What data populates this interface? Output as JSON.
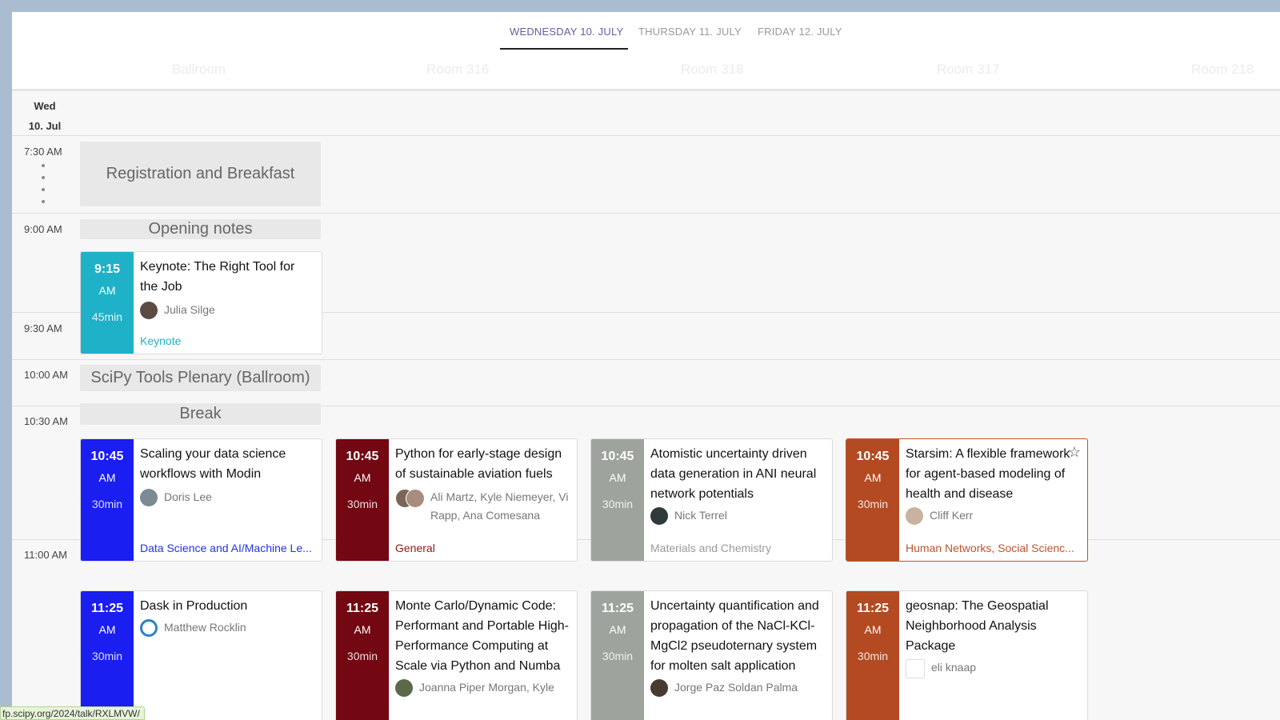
{
  "tabs": [
    {
      "label": "WEDNESDAY 10. JULY",
      "active": true
    },
    {
      "label": "THURSDAY 11. JULY",
      "active": false
    },
    {
      "label": "FRIDAY 12. JULY",
      "active": false
    }
  ],
  "rooms": [
    "Ballroom",
    "Room 316",
    "Room 318",
    "Room 317",
    "Room 218"
  ],
  "day": {
    "weekday": "Wed",
    "date": "10. Jul"
  },
  "times": [
    "7:30 AM",
    "9:00 AM",
    "9:30 AM",
    "10:00 AM",
    "10:30 AM",
    "11:00 AM"
  ],
  "blocks": {
    "registration": "Registration and Breakfast",
    "opening": "Opening notes",
    "plenary": "SciPy Tools Plenary (Ballroom)",
    "break": "Break"
  },
  "talks": {
    "keynote": {
      "time": "9:15",
      "ampm": "AM",
      "duration": "45min",
      "title": "Keynote: The Right Tool for the Job",
      "speaker": "Julia Silge",
      "track": "Keynote",
      "color": "#1fb1c7",
      "track_color": "#1fb1c7"
    },
    "modin": {
      "time": "10:45",
      "ampm": "AM",
      "duration": "30min",
      "title": "Scaling your data science workflows with Modin",
      "speaker": "Doris Lee",
      "track": "Data Science and AI/Machine Le...",
      "color": "#1a1ef0",
      "track_color": "#2233e0"
    },
    "aviation": {
      "time": "10:45",
      "ampm": "AM",
      "duration": "30min",
      "title": "Python for early-stage design of sustainable aviation fuels",
      "speaker": "Ali Martz, Kyle Niemeyer, Vi Rapp, Ana Comesana",
      "track": "General",
      "color": "#730712",
      "track_color": "#8a1a1a"
    },
    "atomistic": {
      "time": "10:45",
      "ampm": "AM",
      "duration": "30min",
      "title": "Atomistic uncertainty driven data generation in ANI neural network potentials",
      "speaker": "Nick Terrel",
      "track": "Materials and Chemistry",
      "color": "#9ea49d",
      "track_color": "#9a9a9a"
    },
    "starsim": {
      "time": "10:45",
      "ampm": "AM",
      "duration": "30min",
      "title": "Starsim: A flexible framework for agent-based modeling of health and disease",
      "speaker": "Cliff Kerr",
      "track": "Human Networks, Social Scienc...",
      "color": "#b34a22",
      "track_color": "#c0542b"
    },
    "dask": {
      "time": "11:25",
      "ampm": "AM",
      "duration": "30min",
      "title": "Dask in Production",
      "speaker": "Matthew Rocklin"
    },
    "montecarlo": {
      "time": "11:25",
      "ampm": "AM",
      "duration": "30min",
      "title": "Monte Carlo/Dynamic Code: Performant and Portable High-Performance Computing at Scale via Python and Numba",
      "speaker": "Joanna Piper Morgan, Kyle"
    },
    "uncertainty": {
      "time": "11:25",
      "ampm": "AM",
      "duration": "30min",
      "title": "Uncertainty quantification and propagation of the NaCl-KCl-MgCl2 pseudoternary system for molten salt application",
      "speaker": "Jorge Paz Soldan Palma"
    },
    "geosnap": {
      "time": "11:25",
      "ampm": "AM",
      "duration": "30min",
      "title": "geosnap: The Geospatial Neighborhood Analysis Package",
      "speaker": "eli knaap"
    }
  },
  "status_url": "fp.scipy.org/2024/talk/RXLMVW/",
  "icons": {
    "star": "star-outline-icon",
    "dask": "dask-logo-icon",
    "knaap": "broken-image-icon"
  }
}
